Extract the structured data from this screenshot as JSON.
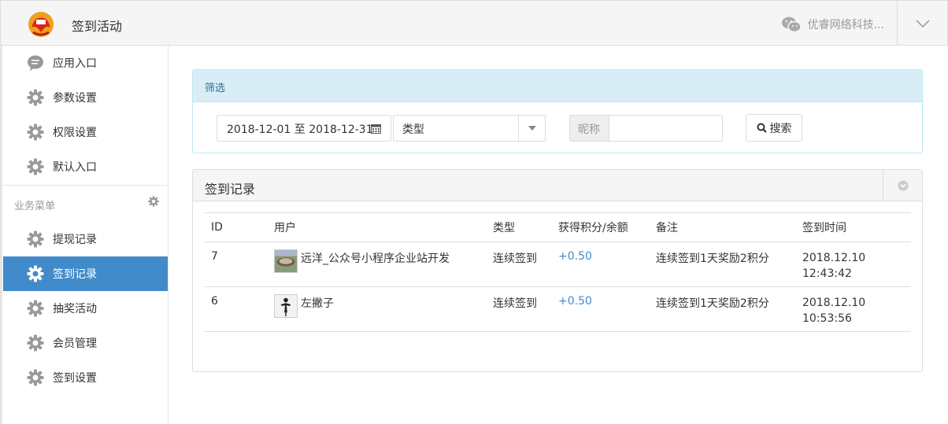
{
  "header": {
    "title": "签到活动",
    "account_name": "优睿网络科技...",
    "logo_icon": "phoenix-logo-icon",
    "wechat_icon": "wechat-icon",
    "toggle_icon": "chevron-down-icon"
  },
  "sidebar": {
    "items_top": [
      {
        "label": "应用入口",
        "icon": "chat-bubble-icon"
      },
      {
        "label": "参数设置",
        "icon": "gear-icon"
      },
      {
        "label": "权限设置",
        "icon": "gear-icon"
      },
      {
        "label": "默认入口",
        "icon": "gear-icon"
      }
    ],
    "section_label": "业务菜单",
    "items_business": [
      {
        "label": "提现记录",
        "icon": "gear-icon",
        "active": false
      },
      {
        "label": "签到记录",
        "icon": "gear-icon",
        "active": true
      },
      {
        "label": "抽奖活动",
        "icon": "gear-icon",
        "active": false
      },
      {
        "label": "会员管理",
        "icon": "gear-icon",
        "active": false
      },
      {
        "label": "签到设置",
        "icon": "gear-icon",
        "active": false
      }
    ],
    "active_color": "#428bca"
  },
  "filter": {
    "title": "筛选",
    "date_range": "2018-12-01 至 2018-12-31",
    "type_value": "类型",
    "nickname_label": "昵称",
    "nickname_value": "",
    "search_label": "搜索"
  },
  "records": {
    "title": "签到记录",
    "columns": [
      "ID",
      "用户",
      "类型",
      "获得积分/余额",
      "备注",
      "签到时间"
    ],
    "rows": [
      {
        "id": "7",
        "user": "远洋_公众号小程序企业站开发",
        "type": "连续签到",
        "points": "+0.50",
        "note": "连续签到1天奖励2积分",
        "date": "2018.12.10",
        "time": "12:43:42"
      },
      {
        "id": "6",
        "user": "左撇子",
        "type": "连续签到",
        "points": "+0.50",
        "note": "连续签到1天奖励2积分",
        "date": "2018.12.10",
        "time": "10:53:56"
      }
    ]
  }
}
